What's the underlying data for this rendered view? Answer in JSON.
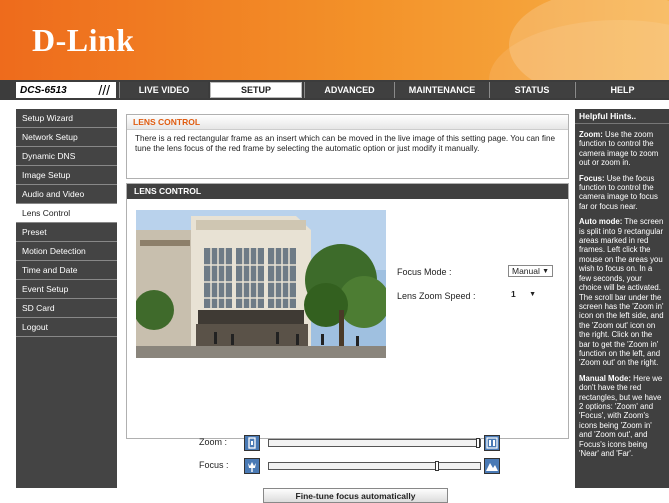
{
  "header": {
    "logo_text": "D-Link",
    "model": "DCS-6513",
    "model_slashes": "///"
  },
  "nav": {
    "tabs": [
      "LIVE VIDEO",
      "SETUP",
      "ADVANCED",
      "MAINTENANCE",
      "STATUS",
      "HELP"
    ],
    "active_tab": "SETUP"
  },
  "sidebar": {
    "items": [
      "Setup Wizard",
      "Network Setup",
      "Dynamic DNS",
      "Image Setup",
      "Audio and Video",
      "Lens Control",
      "Preset",
      "Motion Detection",
      "Time and Date",
      "Event Setup",
      "SD Card",
      "Logout"
    ],
    "active": "Lens Control"
  },
  "info": {
    "title": "LENS CONTROL",
    "text": "There is a red rectangular frame as an insert which can be moved in the live image of this setting page. You can fine tune the lens focus of the red frame by selecting the automatic option or just modify it manually."
  },
  "lens": {
    "title": "LENS CONTROL",
    "focus_mode_label": "Focus Mode  :",
    "focus_mode_value": "Manual",
    "zoom_speed_label": "Lens Zoom Speed  :",
    "zoom_speed_value": "1",
    "zoom_label": "Zoom :",
    "focus_label": "Focus :",
    "zoom_level": 1.0,
    "focus_level": 0.8,
    "fine_tune_button": "Fine-tune focus automatically"
  },
  "help": {
    "title": "Helpful Hints..",
    "zoom_head": "Zoom:",
    "zoom_text": " Use the zoom function to control the camera image to zoom out or zoom in.",
    "focus_head": "Focus:",
    "focus_text": " Use the focus function to control the camera image to focus far or focus near.",
    "auto_head": "Auto mode:",
    "auto_text": " The screen is split into 9 rectangular areas marked in red frames. Left click the mouse on the areas you wish to focus on. In a few seconds, your choice will be activated. The scroll bar under the screen has the 'Zoom in' icon on the left side, and the 'Zoom out' icon on the right. Click on the bar to get the 'Zoom in' function on the left, and 'Zoom out' on the right.",
    "manual_head": "Manual Mode:",
    "manual_text": " Here we don't have the red rectangles, but we have 2 options: 'Zoom' and 'Focus', with Zoom's icons being 'Zoom in' and 'Zoom out', and Focus's icons being 'Near' and 'Far'."
  },
  "colors": {
    "header_orange": "#ee6b1c",
    "nav_dark": "#3c3c3c",
    "title_orange": "#e05c10"
  }
}
